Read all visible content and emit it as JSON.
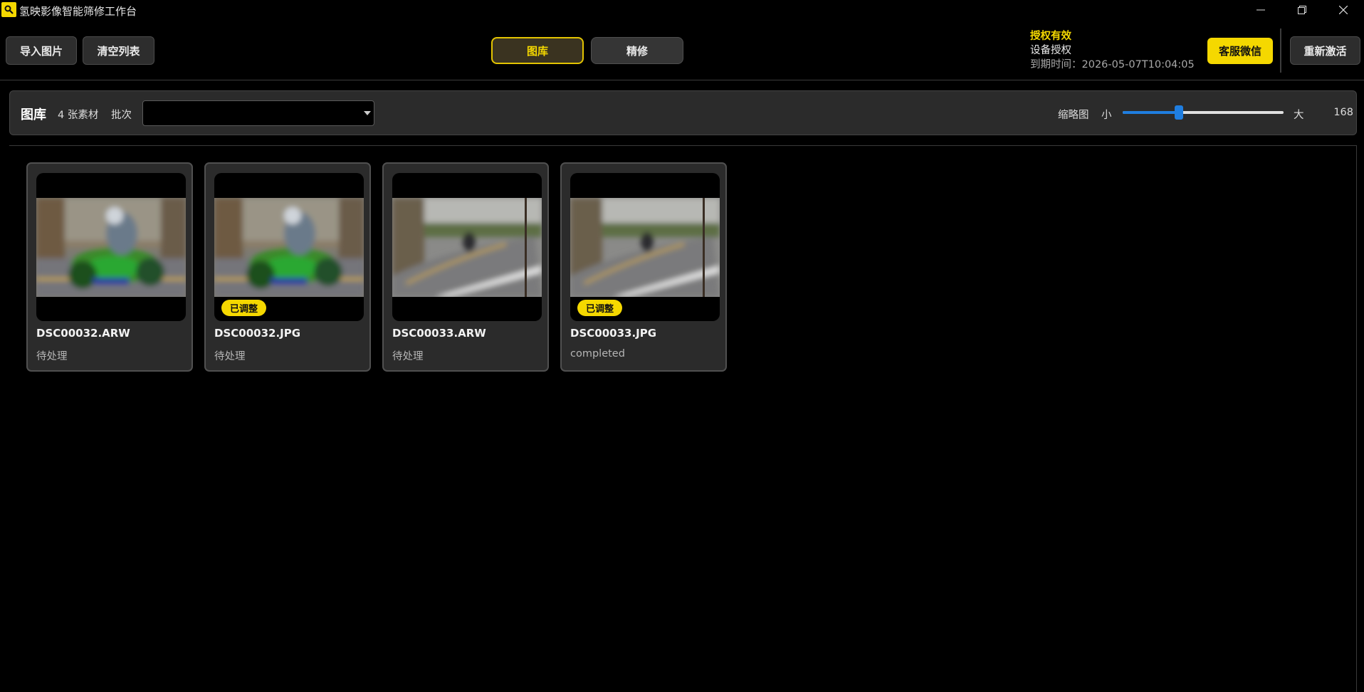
{
  "window": {
    "title": "氢映影像智能筛修工作台",
    "icon": "app-logo-icon",
    "controls": [
      "minimize-icon",
      "restore-icon",
      "close-icon"
    ]
  },
  "toolbar": {
    "import_label": "导入图片",
    "clear_label": "清空列表",
    "tabs": [
      {
        "label": "图库",
        "active": true
      },
      {
        "label": "精修",
        "active": false
      }
    ],
    "license": {
      "status": "授权有效",
      "type": "设备授权",
      "expiry": "到期时间：2026-05-07T10:04:05"
    },
    "wechat_label": "客服微信",
    "reactivate_label": "重新激活"
  },
  "library": {
    "title": "图库",
    "count": "4 张素材",
    "batch_label": "批次",
    "batch_value": "",
    "thumbnail_label": "缩略图",
    "size_small": "小",
    "size_large": "大",
    "size_value": "168",
    "slider_fraction": 0.35
  },
  "items": [
    {
      "name": "DSC00032.ARW",
      "status": "待处理",
      "badge": "",
      "scene": "moto"
    },
    {
      "name": "DSC00032.JPG",
      "status": "待处理",
      "badge": "已调整",
      "scene": "moto"
    },
    {
      "name": "DSC00033.ARW",
      "status": "待处理",
      "badge": "",
      "scene": "road"
    },
    {
      "name": "DSC00033.JPG",
      "status": "completed",
      "badge": "已调整",
      "scene": "road"
    }
  ],
  "colors": {
    "accent": "#f5d800",
    "slider": "#1f7ee0",
    "panel": "#2b2b2b",
    "background": "#000000"
  }
}
